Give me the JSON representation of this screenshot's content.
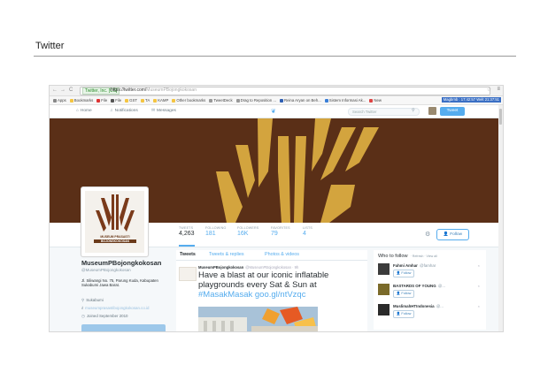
{
  "slide": {
    "title": "Twitter"
  },
  "browser": {
    "nav_back": "←",
    "nav_forward": "→",
    "nav_reload": "C",
    "secure_label": "Twitter, Inc. [US]",
    "url": "https://twitter.com/",
    "url_path": "MuseumPBojongkokosan",
    "menu_icon": "≡",
    "star_icon": "☆",
    "bookmarks": [
      "Apps",
      "Bookmarks",
      "File",
      "File",
      "GST",
      "TA",
      "KAMP",
      "Other bookmarks",
      "TweetDeck",
      "Drag to Reposition ...",
      "Reina Aryan on Beh...",
      "Sistem Informasi Ak...",
      "New"
    ],
    "bookmark_time": "Magbrnb : 17:42:57 Welt 21:37:51"
  },
  "twitter_nav": {
    "home": "Home",
    "notifications": "Notifications",
    "messages": "Messages",
    "search_placeholder": "Search Twitter",
    "compose": "Tweet",
    "home_icon": "home-icon",
    "bird_icon": "bird-icon"
  },
  "profile": {
    "logo_line1": "MUSEUM PRASASTI",
    "logo_line2": "BOJONGKOKOSAN",
    "name": "MuseumPBojongkokosan",
    "handle": "@MuseumPBojongkokosan",
    "bio": "Jl. Siliwangi No. 75, Parung Kuda, Kabupaten Sukabumi Jawa Barat.",
    "location": "Sukabumi",
    "website": "museumprasastibojongkokosan.co.id",
    "joined": "Joined September 2010",
    "stats": [
      {
        "label": "TWEETS",
        "value": "4,263"
      },
      {
        "label": "FOLLOWING",
        "value": "181"
      },
      {
        "label": "FOLLOWERS",
        "value": "16K"
      },
      {
        "label": "FAVORITES",
        "value": "79"
      },
      {
        "label": "LISTS",
        "value": "4"
      }
    ],
    "follow_label": "Follow"
  },
  "timeline": {
    "tabs": [
      "Tweets",
      "Tweets & replies",
      "Photos & videos"
    ],
    "tweet": {
      "name": "MuseumPBojongkokosan",
      "handle": "@MuseumPBojongkokosan · 9h",
      "text": "Have a blast at our iconic inflatable playgrounds every Sat & Sun at",
      "link": "#MasakMasak goo.gl/ntVzqc"
    }
  },
  "who_to_follow": {
    "title": "Who to follow",
    "links": "· Refresh · View all",
    "suggestions": [
      {
        "name": "Fahmi Amhar",
        "handle": "@famhar",
        "follow": "Follow"
      },
      {
        "name": "BASTARDS OF YOUNG",
        "handle": "@...",
        "follow": "Follow"
      },
      {
        "name": "MuslimahHTIndonesia",
        "handle": "@...",
        "follow": "Follow"
      }
    ],
    "close_icon": "×"
  },
  "colors": {
    "banner": "#5a2f17",
    "banner_gold": "#d3a43e",
    "accent": "#55acee"
  }
}
